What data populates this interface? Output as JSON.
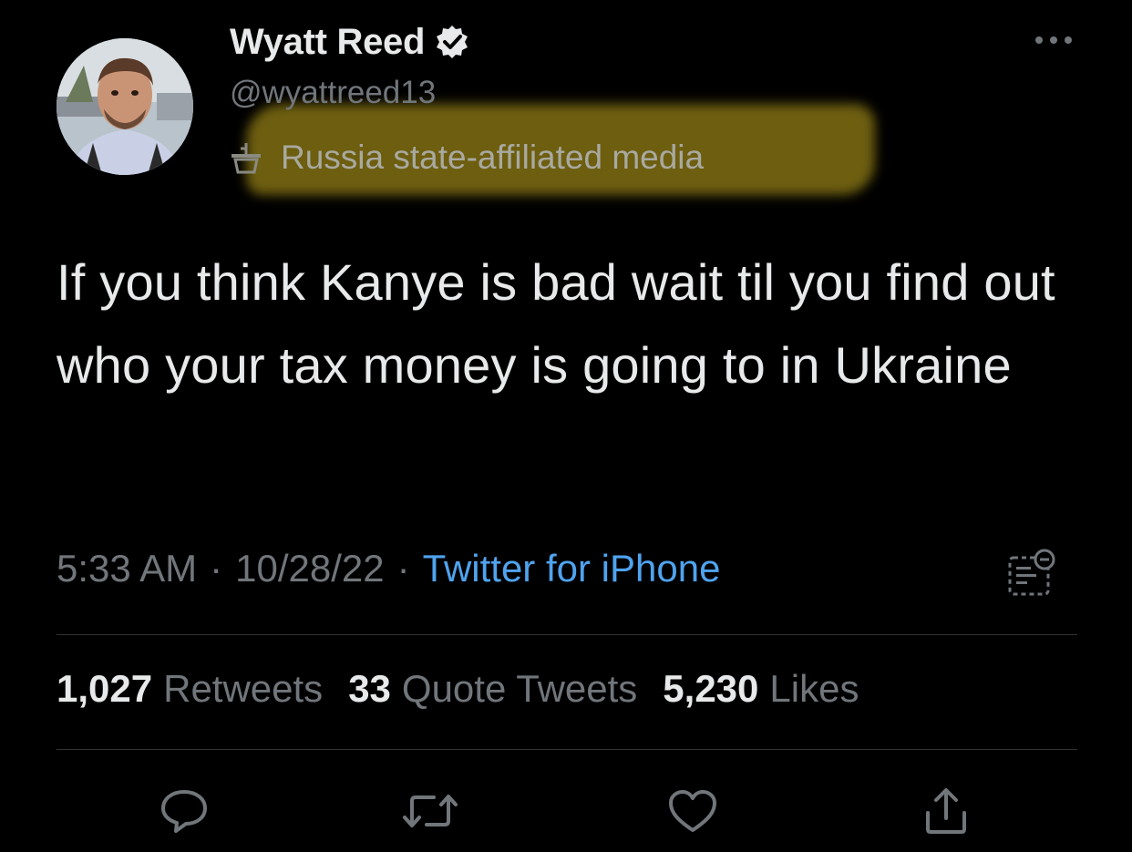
{
  "tweet": {
    "author": {
      "display_name": "Wyatt Reed",
      "handle": "@wyattreed13",
      "verified_icon": "verified-badge-icon",
      "label": "Russia state-affiliated media",
      "label_icon": "state-media-podium-icon"
    },
    "text": "If you think Kanye is bad wait til you find out who your tax money is going to in Ukraine",
    "meta": {
      "time": "5:33 AM",
      "separator": "·",
      "date": "10/28/22",
      "source": "Twitter for iPhone"
    },
    "stats": {
      "retweets_count": "1,027",
      "retweets_label": "Retweets",
      "quotes_count": "33",
      "quotes_label": "Quote Tweets",
      "likes_count": "5,230",
      "likes_label": "Likes"
    },
    "actions": [
      "reply-icon",
      "retweet-icon",
      "like-icon",
      "share-icon"
    ]
  },
  "colors": {
    "background": "#000000",
    "text_primary": "#e7e9ea",
    "text_secondary": "#71767b",
    "link": "#4fa3ef",
    "highlight": "#8c7814"
  }
}
